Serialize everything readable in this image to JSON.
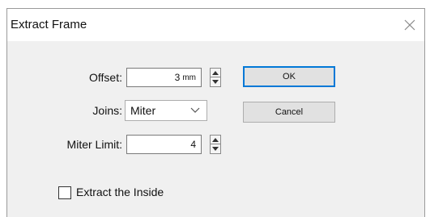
{
  "dialog": {
    "title": "Extract Frame",
    "close_icon": "close-icon"
  },
  "offset": {
    "label": "Offset:",
    "value": "3",
    "unit": "mm"
  },
  "joins": {
    "label": "Joins:",
    "selected": "Miter"
  },
  "miter_limit": {
    "label": "Miter Limit:",
    "value": "4"
  },
  "extract_inside": {
    "label": "Extract the Inside",
    "checked": false
  },
  "buttons": {
    "ok": "OK",
    "cancel": "Cancel"
  },
  "colors": {
    "dialog_bg": "#f0f0f0",
    "title_bg": "#ffffff",
    "default_button_border": "#0078d7"
  }
}
